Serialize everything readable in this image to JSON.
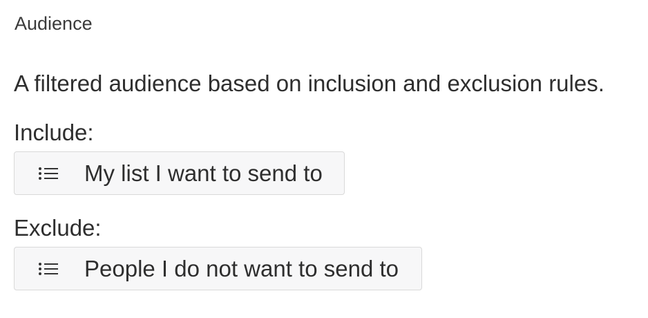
{
  "section": {
    "title": "Audience"
  },
  "description": "A filtered audience based on inclusion and exclusion rules.",
  "include": {
    "label": "Include:",
    "list": {
      "icon": "list-icon",
      "name": "My list I want to send to"
    }
  },
  "exclude": {
    "label": "Exclude:",
    "list": {
      "icon": "list-icon",
      "name": "People I do not want to send to"
    }
  },
  "colors": {
    "text": "#2e2e2e",
    "chip_background": "#f7f7f8",
    "chip_border": "#d9d9d9"
  }
}
